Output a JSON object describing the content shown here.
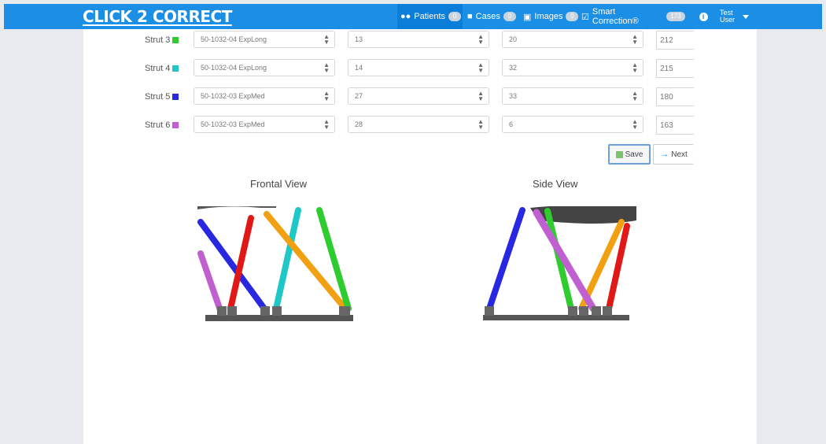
{
  "navbar": {
    "brand": "CLICK 2 CORRECT",
    "items": [
      {
        "label": "Patients",
        "icon": "users-icon",
        "badge": "0"
      },
      {
        "label": "Cases",
        "icon": "briefcase-icon",
        "badge": "0"
      },
      {
        "label": "Images",
        "icon": "image-icon",
        "badge": "0"
      },
      {
        "label": "Smart Correction®",
        "icon": "calendar-check-icon",
        "badge": "173"
      }
    ],
    "info_icon": "info-icon",
    "user": {
      "line1": "Test",
      "line2": "User"
    }
  },
  "struts": [
    {
      "label": "Strut 3",
      "color": "#2ecc2e",
      "part": "50-1032-04 ExpLong",
      "a": "13",
      "b": "20",
      "length": "212"
    },
    {
      "label": "Strut 4",
      "color": "#1fc7c7",
      "part": "50-1032-04 ExpLong",
      "a": "14",
      "b": "32",
      "length": "215"
    },
    {
      "label": "Strut 5",
      "color": "#2828e0",
      "part": "50-1032-03 ExpMed",
      "a": "27",
      "b": "33",
      "length": "180"
    },
    {
      "label": "Strut 6",
      "color": "#c060d0",
      "part": "50-1032-03 ExpMed",
      "a": "28",
      "b": "6",
      "length": "163"
    }
  ],
  "buttons": {
    "save": "Save",
    "next": "Next"
  },
  "views": {
    "frontal_title": "Frontal View",
    "side_title": "Side View"
  }
}
